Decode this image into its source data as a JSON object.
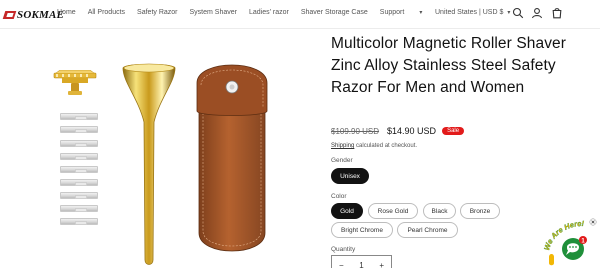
{
  "header": {
    "logo_text": "SOKMAE",
    "nav": [
      {
        "label": "Home"
      },
      {
        "label": "All Products"
      },
      {
        "label": "Safety Razor"
      },
      {
        "label": "System Shaver"
      },
      {
        "label": "Ladies' razor"
      },
      {
        "label": "Shaver Storage Case"
      },
      {
        "label": "Support"
      }
    ],
    "currency": "United States | USD $",
    "icons": [
      "search-icon",
      "account-icon",
      "cart-icon"
    ]
  },
  "product": {
    "title": "Multicolor Magnetic Roller Shaver Zinc Alloy Stainless Steel Safety Razor For Men and Women",
    "compare_price": "$109.90 USD",
    "price": "$14.90 USD",
    "sale_badge": "Sale",
    "shipping_link": "Shipping",
    "shipping_rest": " calculated at checkout.",
    "gender_label": "Gender",
    "gender_options": [
      {
        "label": "Unisex",
        "selected": true
      }
    ],
    "color_label": "Color",
    "color_options": [
      {
        "label": "Gold",
        "selected": true
      },
      {
        "label": "Rose Gold",
        "selected": false
      },
      {
        "label": "Black",
        "selected": false
      },
      {
        "label": "Bronze",
        "selected": false
      },
      {
        "label": "Bright Chrome",
        "selected": false
      },
      {
        "label": "Pearl Chrome",
        "selected": false
      }
    ],
    "quantity_label": "Quantity",
    "quantity_value": "1",
    "qty_minus": "−",
    "qty_plus": "+"
  },
  "chat": {
    "badge_text": "We Are Here!",
    "unread_count": "1"
  },
  "colors": {
    "sale": "#e21b1b",
    "gold": "#d4a017",
    "chat_green": "#1f8f3a",
    "pouch_brown": "#a0522d"
  }
}
